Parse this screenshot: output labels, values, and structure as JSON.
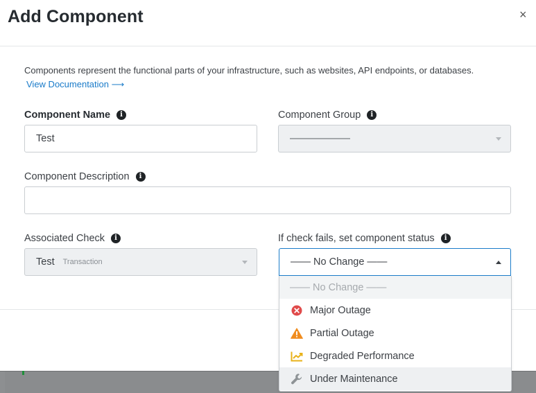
{
  "modal": {
    "title": "Add Component",
    "close_label": "×"
  },
  "intro": {
    "text": "Components represent the functional parts of your infrastructure, such as websites, API endpoints, or databases.",
    "link": "View Documentation ⟶"
  },
  "fields": {
    "component_name": {
      "label": "Component Name",
      "value": "Test"
    },
    "component_group": {
      "label": "Component Group",
      "value": "——————"
    },
    "component_description": {
      "label": "Component Description",
      "value": ""
    },
    "associated_check": {
      "label": "Associated Check",
      "value": "Test",
      "type": "Transaction"
    },
    "fail_status": {
      "label": "If check fails, set component status",
      "value": "—— No Change ——"
    }
  },
  "status_options": [
    {
      "label": "—— No Change ——",
      "icon": "none"
    },
    {
      "label": "Major Outage",
      "icon": "x-circle-icon",
      "color": "#e04a4a"
    },
    {
      "label": "Partial Outage",
      "icon": "warning-icon",
      "color": "#f08c1e"
    },
    {
      "label": "Degraded Performance",
      "icon": "trend-chart-icon",
      "color": "#e8b21a"
    },
    {
      "label": "Under Maintenance",
      "icon": "wrench-icon",
      "color": "#8e9396"
    }
  ],
  "info_glyph": "i"
}
